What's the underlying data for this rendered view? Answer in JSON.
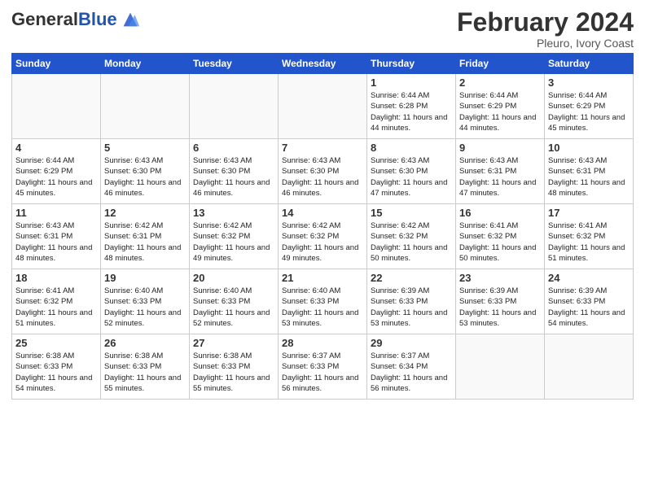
{
  "header": {
    "logo_general": "General",
    "logo_blue": "Blue",
    "month_title": "February 2024",
    "subtitle": "Pleuro, Ivory Coast"
  },
  "days_of_week": [
    "Sunday",
    "Monday",
    "Tuesday",
    "Wednesday",
    "Thursday",
    "Friday",
    "Saturday"
  ],
  "weeks": [
    [
      {
        "day": "",
        "info": ""
      },
      {
        "day": "",
        "info": ""
      },
      {
        "day": "",
        "info": ""
      },
      {
        "day": "",
        "info": ""
      },
      {
        "day": "1",
        "info": "Sunrise: 6:44 AM\nSunset: 6:28 PM\nDaylight: 11 hours\nand 44 minutes."
      },
      {
        "day": "2",
        "info": "Sunrise: 6:44 AM\nSunset: 6:29 PM\nDaylight: 11 hours\nand 44 minutes."
      },
      {
        "day": "3",
        "info": "Sunrise: 6:44 AM\nSunset: 6:29 PM\nDaylight: 11 hours\nand 45 minutes."
      }
    ],
    [
      {
        "day": "4",
        "info": "Sunrise: 6:44 AM\nSunset: 6:29 PM\nDaylight: 11 hours\nand 45 minutes."
      },
      {
        "day": "5",
        "info": "Sunrise: 6:43 AM\nSunset: 6:30 PM\nDaylight: 11 hours\nand 46 minutes."
      },
      {
        "day": "6",
        "info": "Sunrise: 6:43 AM\nSunset: 6:30 PM\nDaylight: 11 hours\nand 46 minutes."
      },
      {
        "day": "7",
        "info": "Sunrise: 6:43 AM\nSunset: 6:30 PM\nDaylight: 11 hours\nand 46 minutes."
      },
      {
        "day": "8",
        "info": "Sunrise: 6:43 AM\nSunset: 6:30 PM\nDaylight: 11 hours\nand 47 minutes."
      },
      {
        "day": "9",
        "info": "Sunrise: 6:43 AM\nSunset: 6:31 PM\nDaylight: 11 hours\nand 47 minutes."
      },
      {
        "day": "10",
        "info": "Sunrise: 6:43 AM\nSunset: 6:31 PM\nDaylight: 11 hours\nand 48 minutes."
      }
    ],
    [
      {
        "day": "11",
        "info": "Sunrise: 6:43 AM\nSunset: 6:31 PM\nDaylight: 11 hours\nand 48 minutes."
      },
      {
        "day": "12",
        "info": "Sunrise: 6:42 AM\nSunset: 6:31 PM\nDaylight: 11 hours\nand 48 minutes."
      },
      {
        "day": "13",
        "info": "Sunrise: 6:42 AM\nSunset: 6:32 PM\nDaylight: 11 hours\nand 49 minutes."
      },
      {
        "day": "14",
        "info": "Sunrise: 6:42 AM\nSunset: 6:32 PM\nDaylight: 11 hours\nand 49 minutes."
      },
      {
        "day": "15",
        "info": "Sunrise: 6:42 AM\nSunset: 6:32 PM\nDaylight: 11 hours\nand 50 minutes."
      },
      {
        "day": "16",
        "info": "Sunrise: 6:41 AM\nSunset: 6:32 PM\nDaylight: 11 hours\nand 50 minutes."
      },
      {
        "day": "17",
        "info": "Sunrise: 6:41 AM\nSunset: 6:32 PM\nDaylight: 11 hours\nand 51 minutes."
      }
    ],
    [
      {
        "day": "18",
        "info": "Sunrise: 6:41 AM\nSunset: 6:32 PM\nDaylight: 11 hours\nand 51 minutes."
      },
      {
        "day": "19",
        "info": "Sunrise: 6:40 AM\nSunset: 6:33 PM\nDaylight: 11 hours\nand 52 minutes."
      },
      {
        "day": "20",
        "info": "Sunrise: 6:40 AM\nSunset: 6:33 PM\nDaylight: 11 hours\nand 52 minutes."
      },
      {
        "day": "21",
        "info": "Sunrise: 6:40 AM\nSunset: 6:33 PM\nDaylight: 11 hours\nand 53 minutes."
      },
      {
        "day": "22",
        "info": "Sunrise: 6:39 AM\nSunset: 6:33 PM\nDaylight: 11 hours\nand 53 minutes."
      },
      {
        "day": "23",
        "info": "Sunrise: 6:39 AM\nSunset: 6:33 PM\nDaylight: 11 hours\nand 53 minutes."
      },
      {
        "day": "24",
        "info": "Sunrise: 6:39 AM\nSunset: 6:33 PM\nDaylight: 11 hours\nand 54 minutes."
      }
    ],
    [
      {
        "day": "25",
        "info": "Sunrise: 6:38 AM\nSunset: 6:33 PM\nDaylight: 11 hours\nand 54 minutes."
      },
      {
        "day": "26",
        "info": "Sunrise: 6:38 AM\nSunset: 6:33 PM\nDaylight: 11 hours\nand 55 minutes."
      },
      {
        "day": "27",
        "info": "Sunrise: 6:38 AM\nSunset: 6:33 PM\nDaylight: 11 hours\nand 55 minutes."
      },
      {
        "day": "28",
        "info": "Sunrise: 6:37 AM\nSunset: 6:33 PM\nDaylight: 11 hours\nand 56 minutes."
      },
      {
        "day": "29",
        "info": "Sunrise: 6:37 AM\nSunset: 6:34 PM\nDaylight: 11 hours\nand 56 minutes."
      },
      {
        "day": "",
        "info": ""
      },
      {
        "day": "",
        "info": ""
      }
    ]
  ]
}
